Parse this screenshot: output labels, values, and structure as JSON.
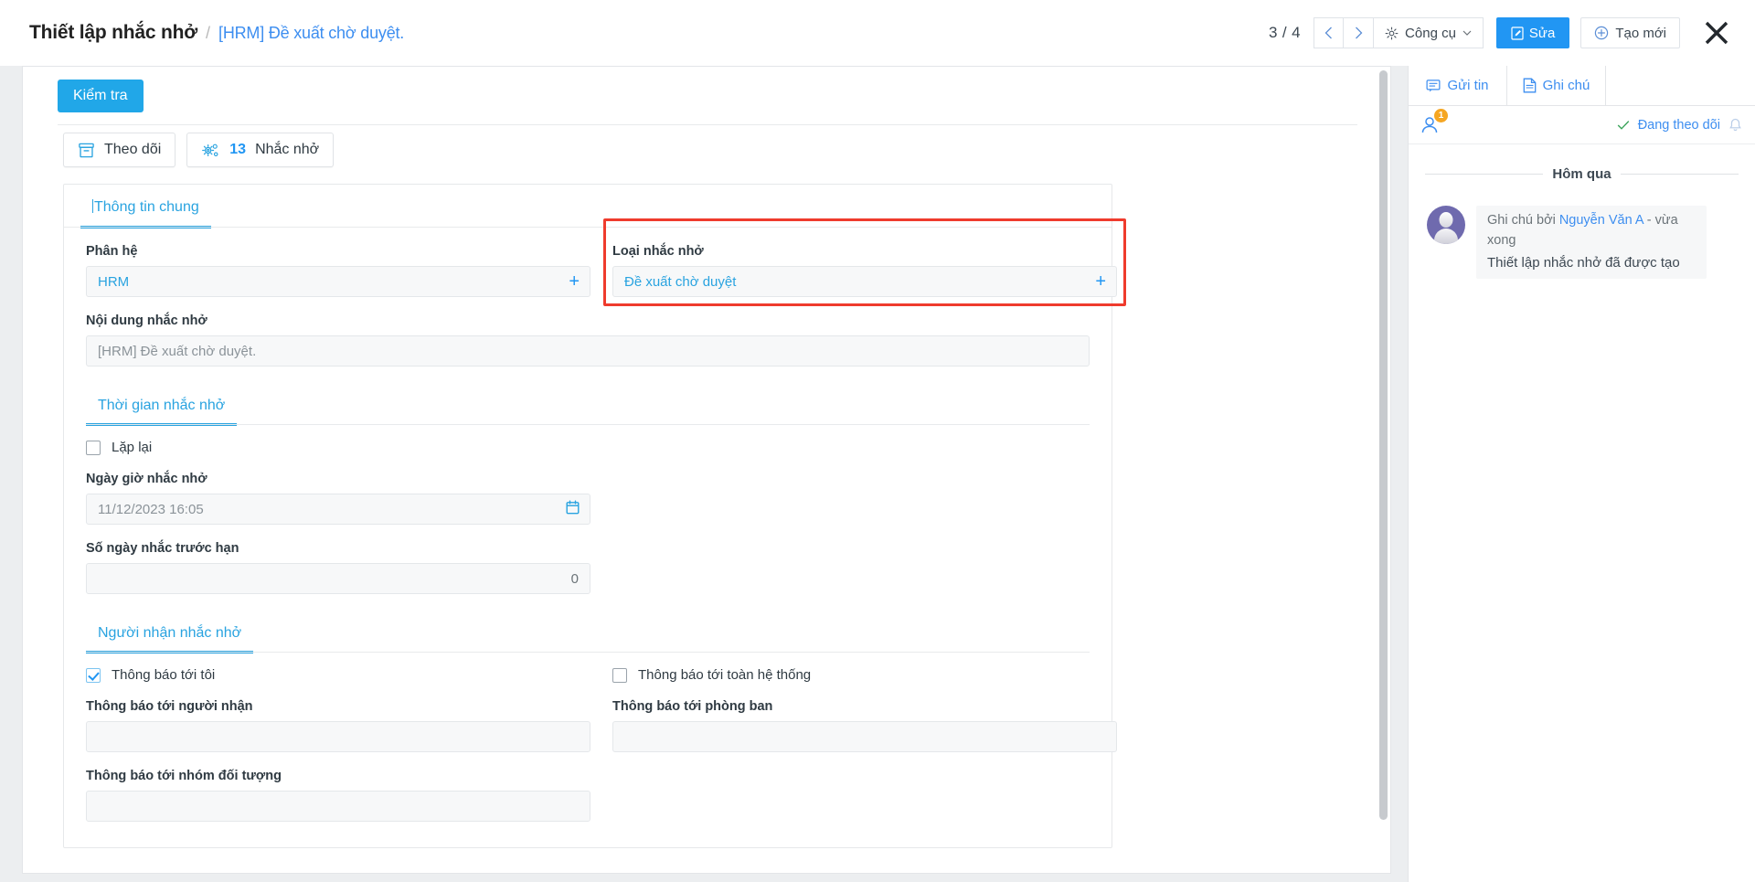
{
  "header": {
    "breadcrumb_title": "Thiết lập nhắc nhở",
    "breadcrumb_separator": "/",
    "breadcrumb_link": "[HRM] Đề xuất chờ duyệt.",
    "pager": "3 / 4",
    "prev_label": "‹",
    "next_label": "›",
    "tools_label": "Công cụ",
    "edit_label": "Sửa",
    "create_label": "Tạo mới",
    "close_label": "✕"
  },
  "toolbar": {
    "check_label": "Kiểm tra",
    "follow_label": "Theo dõi",
    "reminder_count": "13",
    "reminder_label": "Nhắc nhở"
  },
  "form": {
    "tab_general": "Thông tin chung",
    "subsystem_label": "Phân hệ",
    "subsystem_value": "HRM",
    "reminder_type_label": "Loại nhắc nhở",
    "reminder_type_value": "Đề xuất chờ duyệt",
    "content_label": "Nội dung nhắc nhở",
    "content_value": "[HRM] Đề xuất chờ duyệt.",
    "tab_time": "Thời gian nhắc nhở",
    "repeat_label": "Lặp lại",
    "repeat_checked": false,
    "datetime_label": "Ngày giờ nhắc nhở",
    "datetime_value": "11/12/2023 16:05",
    "days_before_label": "Số ngày nhắc trước hạn",
    "days_before_value": "0",
    "tab_recipients": "Người nhận nhắc nhở",
    "notify_me_label": "Thông báo tới tôi",
    "notify_me_checked": true,
    "notify_all_label": "Thông báo tới toàn hệ thống",
    "notify_all_checked": false,
    "notify_person_label": "Thông báo tới người nhận",
    "notify_person_value": "",
    "notify_dept_label": "Thông báo tới phòng ban",
    "notify_dept_value": "",
    "notify_group_label": "Thông báo tới nhóm đối tượng",
    "notify_group_value": "",
    "plus_glyph": "+"
  },
  "sidebar": {
    "tab_message": "Gửi tin",
    "tab_note": "Ghi chú",
    "follower_badge": "1",
    "following_label": "Đang theo dõi",
    "day_divider": "Hôm qua",
    "note_prefix": "Ghi chú bởi",
    "note_author": "Nguyễn Văn A",
    "note_time": "- vừa xong",
    "note_text": "Thiết lập nhắc nhở đã được tạo"
  },
  "colors": {
    "accent_blue": "#2196f3",
    "link_blue": "#3d8ef0",
    "tab_blue": "#29a3e0",
    "highlight_red": "#ef3b2d",
    "badge_orange": "#f5a623"
  }
}
